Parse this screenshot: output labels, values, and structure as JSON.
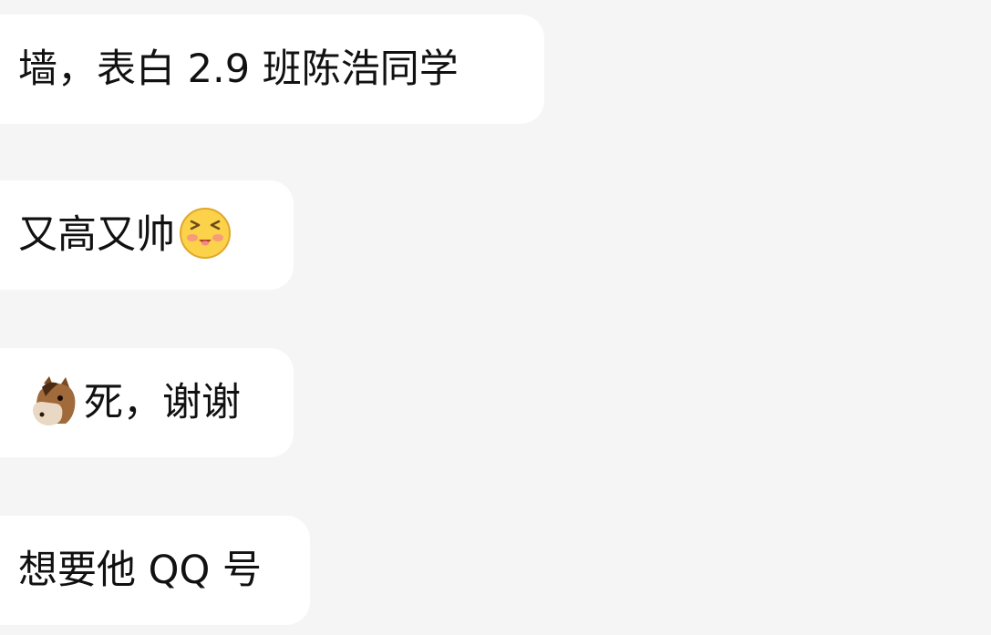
{
  "messages": [
    {
      "text": "墙，表白 2.9 班陈浩同学",
      "emoji_after": null,
      "emoji_before": null
    },
    {
      "text": "又高又帅",
      "emoji_after": "smiling-face-icon",
      "emoji_before": null
    },
    {
      "text": "死，谢谢",
      "emoji_after": null,
      "emoji_before": "horse-face-icon"
    },
    {
      "text": "想要他 QQ 号",
      "emoji_after": null,
      "emoji_before": null
    }
  ],
  "colors": {
    "background": "#f5f5f5",
    "bubble": "#ffffff",
    "text": "#111111"
  }
}
